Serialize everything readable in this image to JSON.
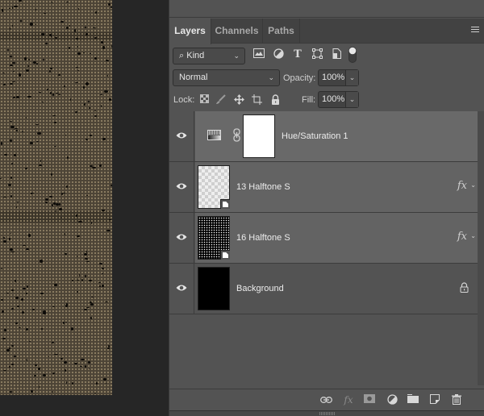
{
  "panel": {
    "tabs": [
      {
        "label": "Layers",
        "active": true
      },
      {
        "label": "Channels",
        "active": false
      },
      {
        "label": "Paths",
        "active": false
      }
    ],
    "menu_icon": "hamburger-menu-icon"
  },
  "filter": {
    "kind_label": "Kind",
    "icons": [
      "pixel-layer-filter-icon",
      "adjustment-layer-filter-icon",
      "type-layer-filter-icon",
      "shape-layer-filter-icon",
      "smart-object-filter-icon",
      "filter-toggle-switch"
    ]
  },
  "blend": {
    "mode": "Normal",
    "opacity_label": "Opacity:",
    "opacity_value": "100%"
  },
  "lock": {
    "label": "Lock:",
    "icons": [
      "lock-transparent-pixels-icon",
      "lock-image-pixels-icon",
      "lock-position-icon",
      "lock-artboard-icon",
      "lock-all-icon"
    ],
    "fill_label": "Fill:",
    "fill_value": "100%"
  },
  "layers": [
    {
      "name": "Hue/Saturation 1",
      "type": "adjustment",
      "visible": true,
      "selected": true,
      "fx": false,
      "locked": false
    },
    {
      "name": "13 Halftone S",
      "type": "smart-object",
      "visible": true,
      "selected": false,
      "fx": true,
      "locked": false
    },
    {
      "name": "16 Halftone S",
      "type": "smart-object",
      "visible": true,
      "selected": false,
      "fx": true,
      "locked": false
    },
    {
      "name": "Background",
      "type": "background",
      "visible": true,
      "selected": false,
      "fx": false,
      "locked": true
    }
  ],
  "fx_label": "fx",
  "bottom_bar": {
    "icons": [
      "link-layers-icon",
      "add-layer-style-icon",
      "add-mask-icon",
      "new-adjustment-layer-icon",
      "new-group-icon",
      "new-layer-icon",
      "delete-layer-icon"
    ]
  }
}
